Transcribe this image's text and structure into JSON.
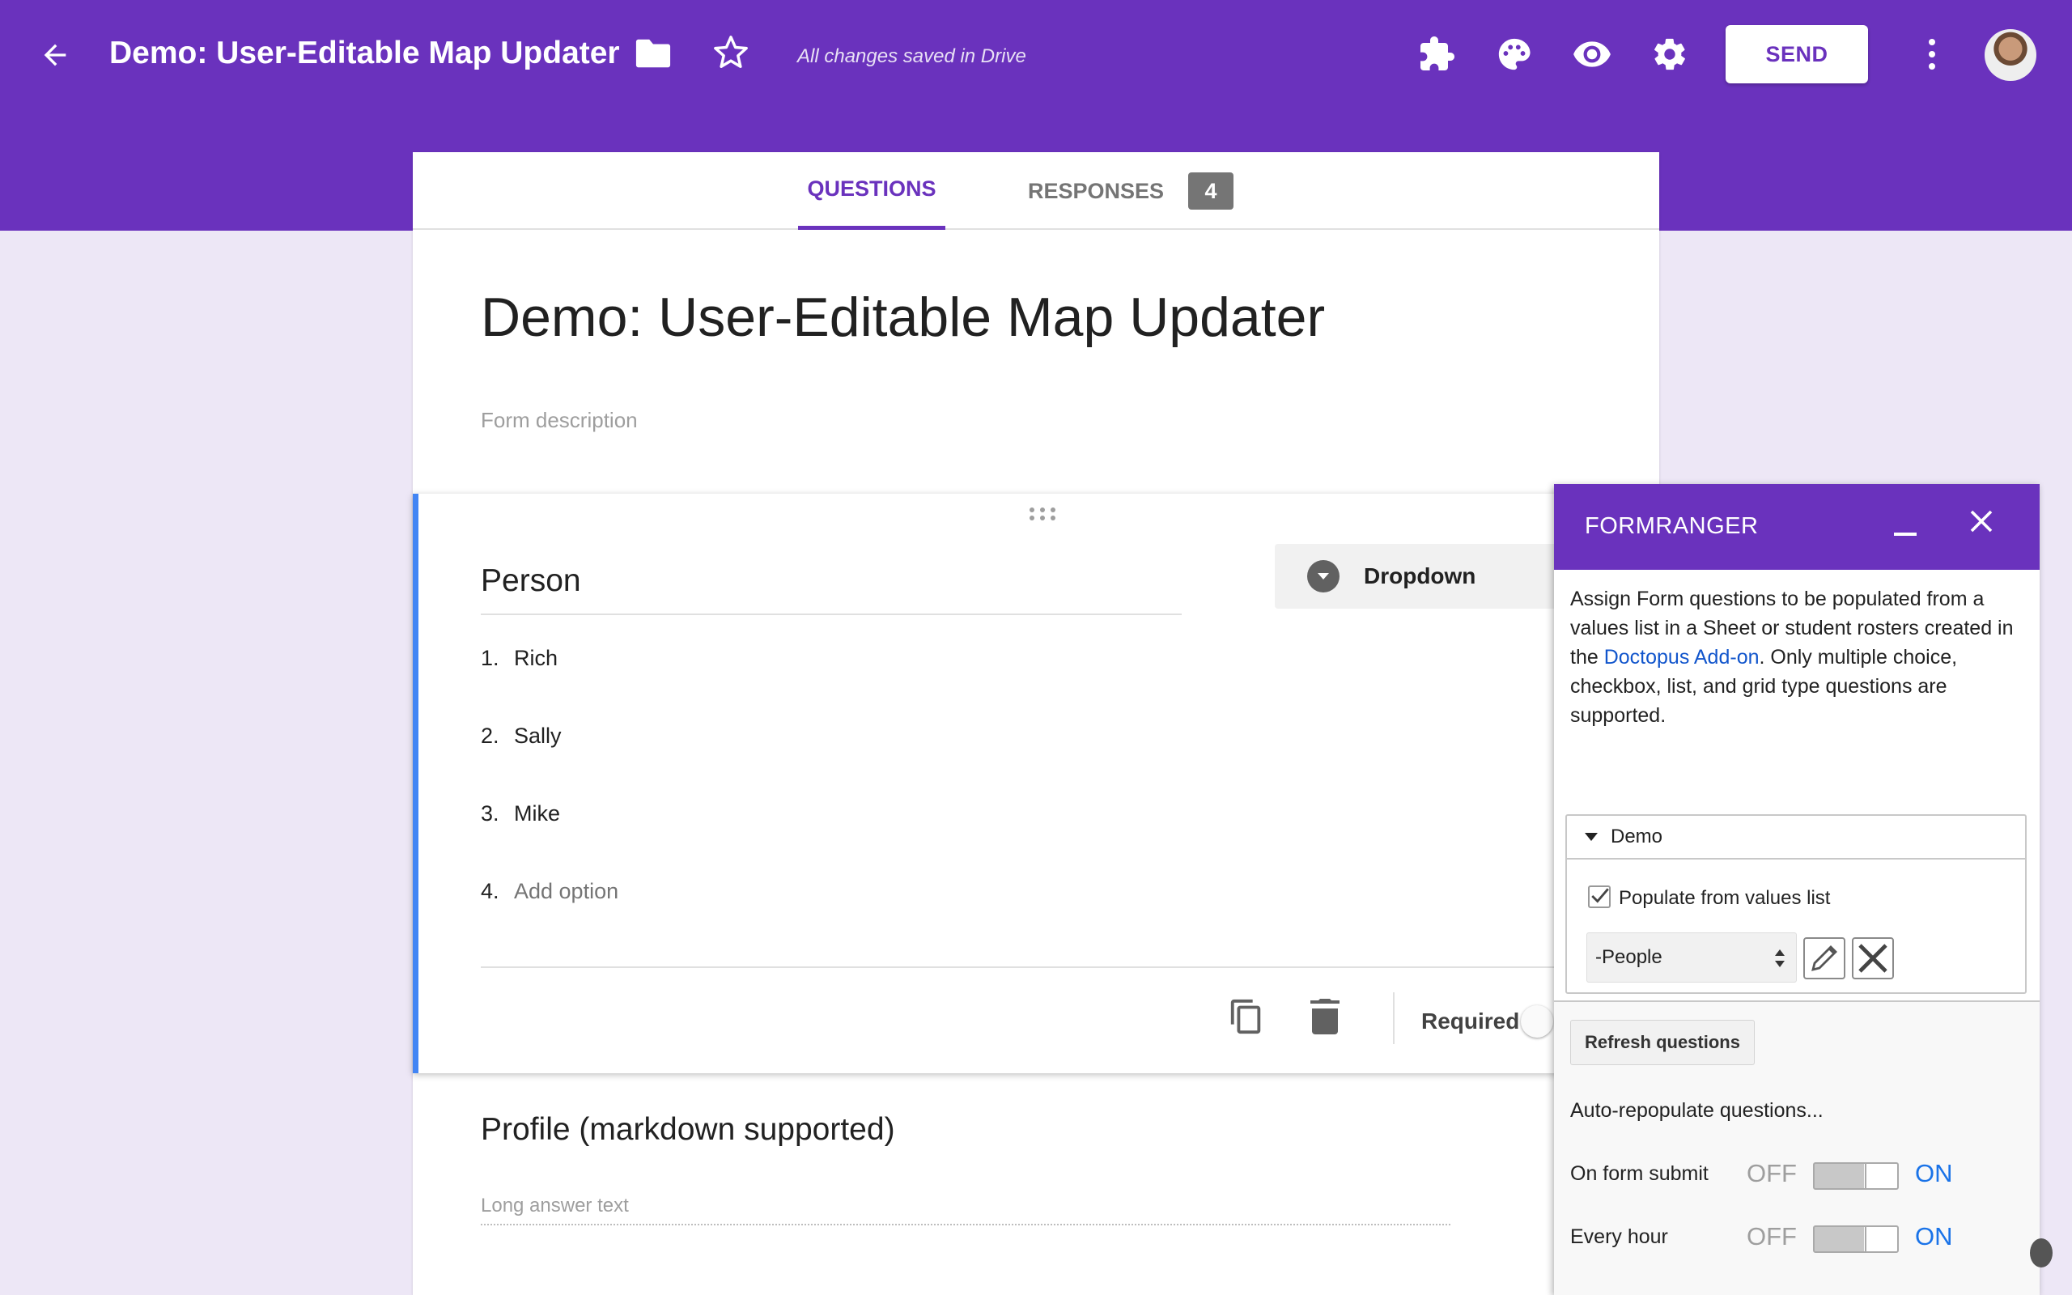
{
  "app": {
    "title": "Demo: User-Editable Map Updater",
    "save_status": "All changes saved in Drive",
    "send_label": "SEND",
    "accent_color": "#6a32bd",
    "toolbar_icons": [
      "addons-icon",
      "palette-icon",
      "preview-eye-icon",
      "settings-gear-icon",
      "more-vert-icon"
    ]
  },
  "tabs": {
    "questions": "QUESTIONS",
    "responses": "RESPONSES",
    "responses_count": "4"
  },
  "form": {
    "title": "Demo: User-Editable Map Updater",
    "description_placeholder": "Form description"
  },
  "question1": {
    "title": "Person",
    "type": "Dropdown",
    "options": [
      {
        "num": "1.",
        "label": "Rich"
      },
      {
        "num": "2.",
        "label": "Sally"
      },
      {
        "num": "3.",
        "label": "Mike"
      }
    ],
    "add_option": {
      "num": "4.",
      "label": "Add option"
    },
    "required_label": "Required"
  },
  "question2": {
    "title": "Profile (markdown supported)",
    "placeholder": "Long answer text"
  },
  "formranger": {
    "title": "FORMRANGER",
    "desc_part1": "Assign Form questions to be populated from a values list in a Sheet or student rosters created in the ",
    "desc_link": "Doctopus Add-on",
    "desc_part2": ". Only multiple choice, checkbox, list, and grid type questions are supported.",
    "section_label": "Demo",
    "checkbox_label": "Populate from values list",
    "checkbox_checked": true,
    "select_value": "-People",
    "refresh_label": "Refresh questions",
    "auto_label": "Auto-repopulate questions...",
    "toggles": [
      {
        "label": "On form submit",
        "off": "OFF",
        "on": "ON"
      },
      {
        "label": "Every hour",
        "off": "OFF",
        "on": "ON"
      }
    ]
  }
}
